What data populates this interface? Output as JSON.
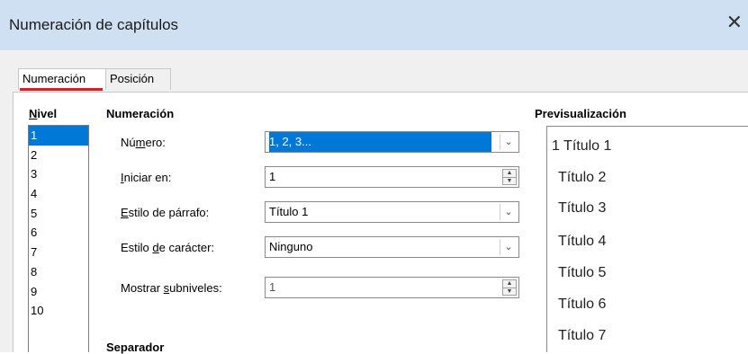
{
  "window": {
    "title": "Numeración de capítulos",
    "close_glyph": "✕"
  },
  "tabs": [
    {
      "label": "Numeración",
      "active": true
    },
    {
      "label": "Posición",
      "active": false
    }
  ],
  "level": {
    "heading_underlined": "N",
    "heading_rest": "ivel",
    "items": [
      "1",
      "2",
      "3",
      "4",
      "5",
      "6",
      "7",
      "8",
      "9",
      "10"
    ],
    "selected": "1"
  },
  "numbering": {
    "heading": "Numeración",
    "number": {
      "label_pre": "Nú",
      "label_u": "m",
      "label_post": "ero:",
      "value": "1, 2, 3..."
    },
    "start_at": {
      "label_u": "I",
      "label_post": "niciar en:",
      "value": "1"
    },
    "paragraph_style": {
      "label_u": "E",
      "label_post": "stilo de párrafo:",
      "value": "Título 1"
    },
    "character_style": {
      "label_pre": "Estilo ",
      "label_u": "d",
      "label_post": "e carácter:",
      "value": "Ninguno"
    },
    "show_sublevels": {
      "label_pre": "Mostrar ",
      "label_u": "s",
      "label_post": "ubniveles:",
      "value": "1"
    }
  },
  "separator": {
    "heading": "Separador"
  },
  "preview": {
    "heading": "Previsualización",
    "lines": [
      "1 Título 1",
      "Título 2",
      "Título 3",
      "Título 4",
      "Título 5",
      "Título 6",
      "Título 7"
    ]
  },
  "colors": {
    "accent": "#0078d7",
    "tab_underline": "#e01b24",
    "titlebar": "#cfe0f3"
  }
}
